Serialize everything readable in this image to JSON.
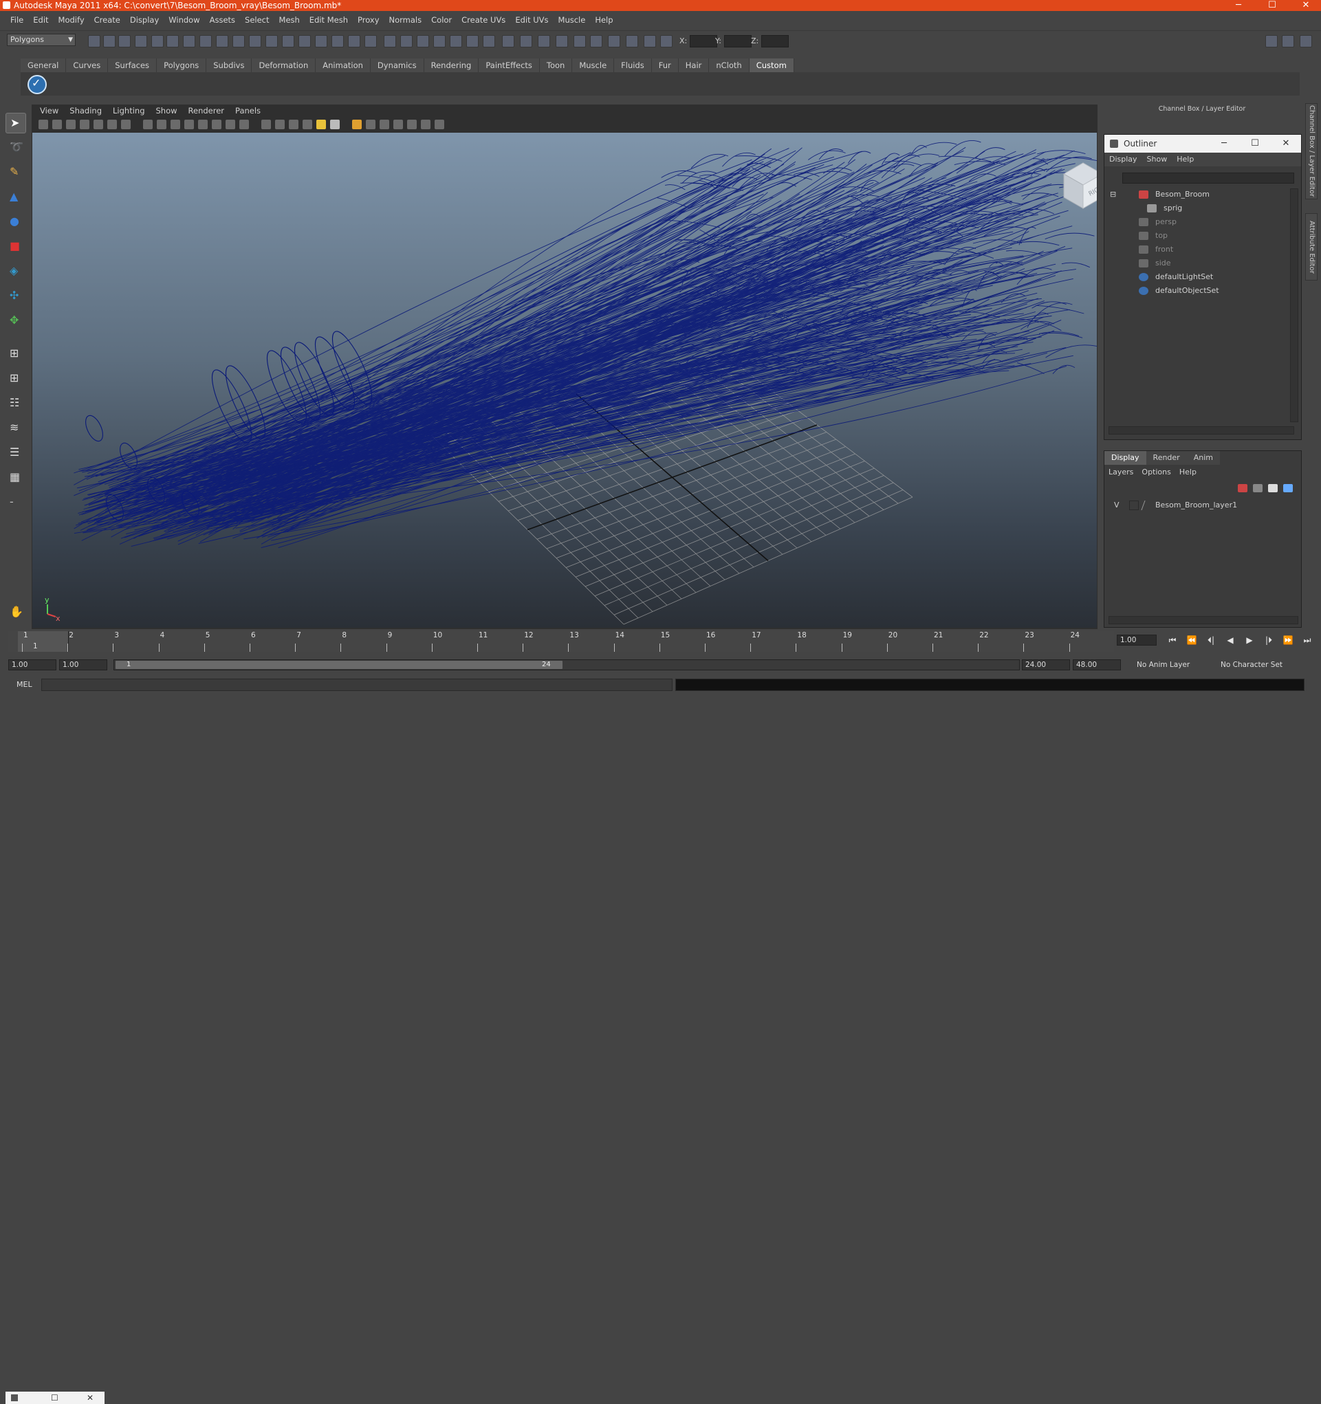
{
  "window": {
    "title": "Autodesk Maya 2011 x64: C:\\convert\\7\\Besom_Broom_vray\\Besom_Broom.mb*",
    "minimize": "─",
    "maximize": "☐",
    "close": "✕"
  },
  "menubar": [
    "File",
    "Edit",
    "Modify",
    "Create",
    "Display",
    "Window",
    "Assets",
    "Select",
    "Mesh",
    "Edit Mesh",
    "Proxy",
    "Normals",
    "Color",
    "Create UVs",
    "Edit UVs",
    "Muscle",
    "Help"
  ],
  "statusline": {
    "mode": "Polygons",
    "x_label": "X:",
    "y_label": "Y:",
    "z_label": "Z:"
  },
  "shelf": {
    "tabs": [
      "General",
      "Curves",
      "Surfaces",
      "Polygons",
      "Subdivs",
      "Deformation",
      "Animation",
      "Dynamics",
      "Rendering",
      "PaintEffects",
      "Toon",
      "Muscle",
      "Fluids",
      "Fur",
      "Hair",
      "nCloth",
      "Custom"
    ],
    "active_tab": "Custom",
    "item_glyph": "✓"
  },
  "panel": {
    "menu": [
      "View",
      "Shading",
      "Lighting",
      "Show",
      "Renderer",
      "Panels"
    ],
    "view_cube_label": "RIGHT",
    "axis_y": "y",
    "axis_x": "x"
  },
  "channel_box": {
    "title": "Channel Box / Layer Editor"
  },
  "outliner": {
    "title": "Outliner",
    "menu": [
      "Display",
      "Show",
      "Help"
    ],
    "items": [
      {
        "label": "Besom_Broom",
        "dim": false,
        "indent": 0
      },
      {
        "label": "sprig",
        "dim": false,
        "indent": 1
      },
      {
        "label": "persp",
        "dim": true,
        "indent": 0
      },
      {
        "label": "top",
        "dim": true,
        "indent": 0
      },
      {
        "label": "front",
        "dim": true,
        "indent": 0
      },
      {
        "label": "side",
        "dim": true,
        "indent": 0
      },
      {
        "label": "defaultLightSet",
        "dim": false,
        "indent": 0
      },
      {
        "label": "defaultObjectSet",
        "dim": false,
        "indent": 0
      }
    ]
  },
  "layer_editor": {
    "tabs": [
      "Display",
      "Render",
      "Anim"
    ],
    "active_tab": "Display",
    "menu": [
      "Layers",
      "Options",
      "Help"
    ],
    "layer": {
      "visible": "V",
      "name": "Besom_Broom_layer1"
    }
  },
  "side_tabs": [
    "Channel Box / Layer Editor",
    "Attribute Editor"
  ],
  "timeline": {
    "labels": [
      "1",
      "2",
      "3",
      "4",
      "5",
      "6",
      "7",
      "8",
      "9",
      "10",
      "11",
      "12",
      "13",
      "14",
      "15",
      "16",
      "17",
      "18",
      "19",
      "20",
      "21",
      "22",
      "23",
      "24"
    ],
    "current_time": "1",
    "current_frame_field": "1.00"
  },
  "range": {
    "start": "1.00",
    "playback_start": "1.00",
    "handle_start": "1",
    "handle_end": "24",
    "playback_end": "24.00",
    "end": "48.00",
    "anim_layer": "No Anim Layer",
    "character_set": "No Character Set"
  },
  "playback_buttons": [
    "⏮",
    "⏪",
    "⏴|",
    "◀",
    "▶",
    "|⏵",
    "⏩",
    "⏭"
  ],
  "command_line": {
    "label": "MEL"
  }
}
